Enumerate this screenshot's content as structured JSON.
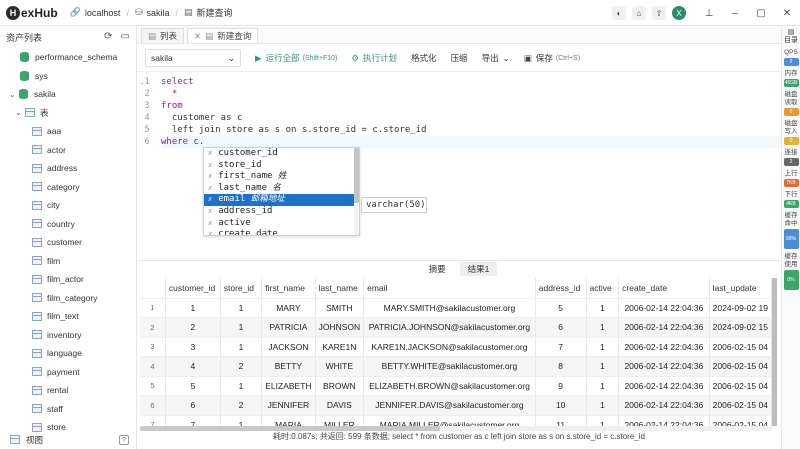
{
  "app": {
    "logo_letter": "H",
    "logo_text": "exHub",
    "crumb_host": "localhost",
    "crumb_db": "sakila",
    "crumb_query": "新建查询",
    "avatar_letter": "X"
  },
  "sidebar": {
    "title": "资产列表",
    "items": [
      {
        "label": "performance_schema",
        "kind": "db"
      },
      {
        "label": "sys",
        "kind": "db"
      },
      {
        "label": "sakila",
        "kind": "db-open"
      },
      {
        "label": "表",
        "kind": "folder"
      }
    ],
    "tables": [
      "aaa",
      "actor",
      "address",
      "category",
      "city",
      "country",
      "customer",
      "film",
      "film_actor",
      "film_category",
      "film_text",
      "inventory",
      "language",
      "payment",
      "rental",
      "staff",
      "store"
    ],
    "footer_label": "视图",
    "footer_help": "?"
  },
  "tabs": [
    {
      "label": "列表"
    },
    {
      "label": "新建查询"
    }
  ],
  "toolbar": {
    "db": "sakila",
    "run_all": "运行全部",
    "run_all_hint": "(Shift+F10)",
    "explain": "执行计划",
    "format": "格式化",
    "compress": "压缩",
    "export": "导出",
    "save": "保存",
    "save_hint": "(Ctrl+S)"
  },
  "editor": {
    "line_numbers": [
      "1",
      "2",
      "3",
      "4",
      "5",
      "6"
    ],
    "lines": [
      {
        "kw": "select",
        "rest": ""
      },
      {
        "kw": "",
        "sym": "  *",
        "rest": ""
      },
      {
        "kw": "from",
        "rest": ""
      },
      {
        "kw": "",
        "rest": "  customer as c"
      },
      {
        "kw": "",
        "rest": "  left join store as s on s.store_id = c.store_id"
      },
      {
        "kw": "where",
        "rest": " c."
      }
    ]
  },
  "autocomplete": {
    "type_marker": "x",
    "items": [
      {
        "name": "customer_id",
        "comment": ""
      },
      {
        "name": "store_id",
        "comment": ""
      },
      {
        "name": "first_name",
        "comment": "姓"
      },
      {
        "name": "last_name",
        "comment": "名"
      },
      {
        "name": "email",
        "comment": "邮箱地址"
      },
      {
        "name": "address_id",
        "comment": ""
      },
      {
        "name": "active",
        "comment": ""
      },
      {
        "name": "create_date",
        "comment": ""
      }
    ],
    "selected_index": 4,
    "detail": "varchar(50)"
  },
  "results": {
    "tabs": [
      "摘要",
      "结果1"
    ],
    "columns": [
      "",
      "customer_id",
      "store_id",
      "first_name",
      "last_name",
      "email",
      "address_id",
      "active",
      "create_date",
      "last_update"
    ],
    "rows": [
      [
        "1",
        "1",
        "1",
        "MARY",
        "SMITH",
        "MARY.SMITH@sakilacustomer.org",
        "5",
        "1",
        "2006-02-14 22:04:36",
        "2024-09-02 19"
      ],
      [
        "2",
        "2",
        "1",
        "PATRICIA",
        "JOHNSON",
        "PATRICIA.JOHNSON@sakilacustomer.org",
        "6",
        "1",
        "2006-02-14 22:04:36",
        "2024-09-02 15"
      ],
      [
        "3",
        "3",
        "1",
        "JACKSON",
        "KARE1N",
        "KARE1N.JACKSON@sakilacustomer.org",
        "7",
        "1",
        "2006-02-14 22:04:36",
        "2006-02-15 04"
      ],
      [
        "4",
        "4",
        "2",
        "BETTY",
        "WHITE",
        "BETTY.WHITE@sakilacustomer.org",
        "8",
        "1",
        "2006-02-14 22:04:36",
        "2006-02-15 04"
      ],
      [
        "5",
        "5",
        "1",
        "ELIZABETH",
        "BROWN",
        "ELIZABETH.BROWN@sakilacustomer.org",
        "9",
        "1",
        "2006-02-14 22:04:36",
        "2006-02-15 04"
      ],
      [
        "6",
        "6",
        "2",
        "JENNIFER",
        "DAVIS",
        "JENNIFER.DAVIS@sakilacustomer.org",
        "10",
        "1",
        "2006-02-14 22:04:36",
        "2006-02-15 04"
      ],
      [
        "7",
        "7",
        "1",
        "MARIA",
        "MILLER",
        "MARIA.MILLER@sakilacustomer.org",
        "11",
        "1",
        "2006-02-14 22:04:36",
        "2006-02-15 04"
      ]
    ],
    "status": "耗时:0.087s; 共返回: 599 条数据; select * from customer as c left join store as s on s.store_id = c.store_id"
  },
  "rightbar": {
    "top_label": "目录",
    "metrics": [
      {
        "label": "QPS",
        "value": "2",
        "color": "#4a8fd6"
      },
      {
        "label": "内存",
        "value": "46GB",
        "color": "#3aa66a"
      },
      {
        "label": "磁盘读取",
        "value": "0",
        "color": "#e59a3a"
      },
      {
        "label": "磁盘写入",
        "value": "0",
        "color": "#e5b03a"
      },
      {
        "label": "连接",
        "value": "2",
        "color": "#666666"
      },
      {
        "label": "上行",
        "value": "7KB",
        "color": "#e06a3a"
      },
      {
        "label": "下行",
        "value": "4KB",
        "color": "#3aa66a"
      },
      {
        "label": "缓存命中",
        "value": "99%",
        "color": "#4a8fd6"
      },
      {
        "label": "缓存使用",
        "value": "0%",
        "color": "#3aa66a"
      }
    ]
  },
  "colors": {
    "accent": "#2e9a6a",
    "selection": "#1a73c9"
  }
}
